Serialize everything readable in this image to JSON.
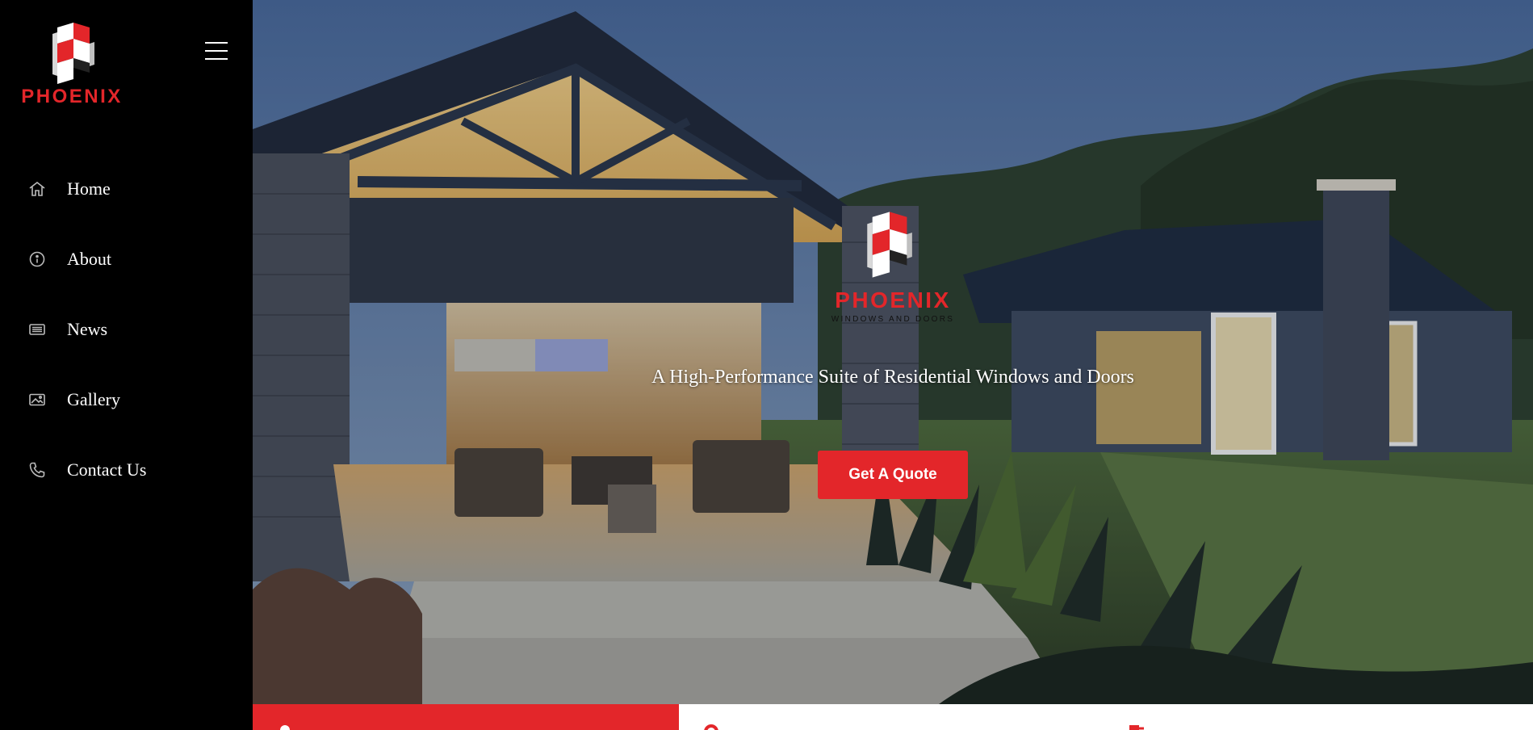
{
  "brand": {
    "name": "PHOENIX",
    "tagline_sub": "WINDOWS AND DOORS",
    "accent_color": "#e3262a"
  },
  "sidebar": {
    "menu_icon": "hamburger-icon",
    "items": [
      {
        "label": "Home",
        "icon": "home-icon"
      },
      {
        "label": "About",
        "icon": "info-icon"
      },
      {
        "label": "News",
        "icon": "newspaper-icon"
      },
      {
        "label": "Gallery",
        "icon": "image-icon"
      },
      {
        "label": "Contact Us",
        "icon": "phone-icon"
      }
    ]
  },
  "hero": {
    "background": "modern house with stone pillars at dusk",
    "headline": "A High-Performance Suite of Residential Windows and Doors",
    "cta_label": "Get A Quote"
  },
  "feature_strip": {
    "cards": [
      {
        "icon": "location-icon",
        "color": "#e3262a"
      },
      {
        "icon": "settings-icon",
        "color": "#ffffff"
      },
      {
        "icon": "document-icon",
        "color": "#ffffff"
      }
    ]
  }
}
